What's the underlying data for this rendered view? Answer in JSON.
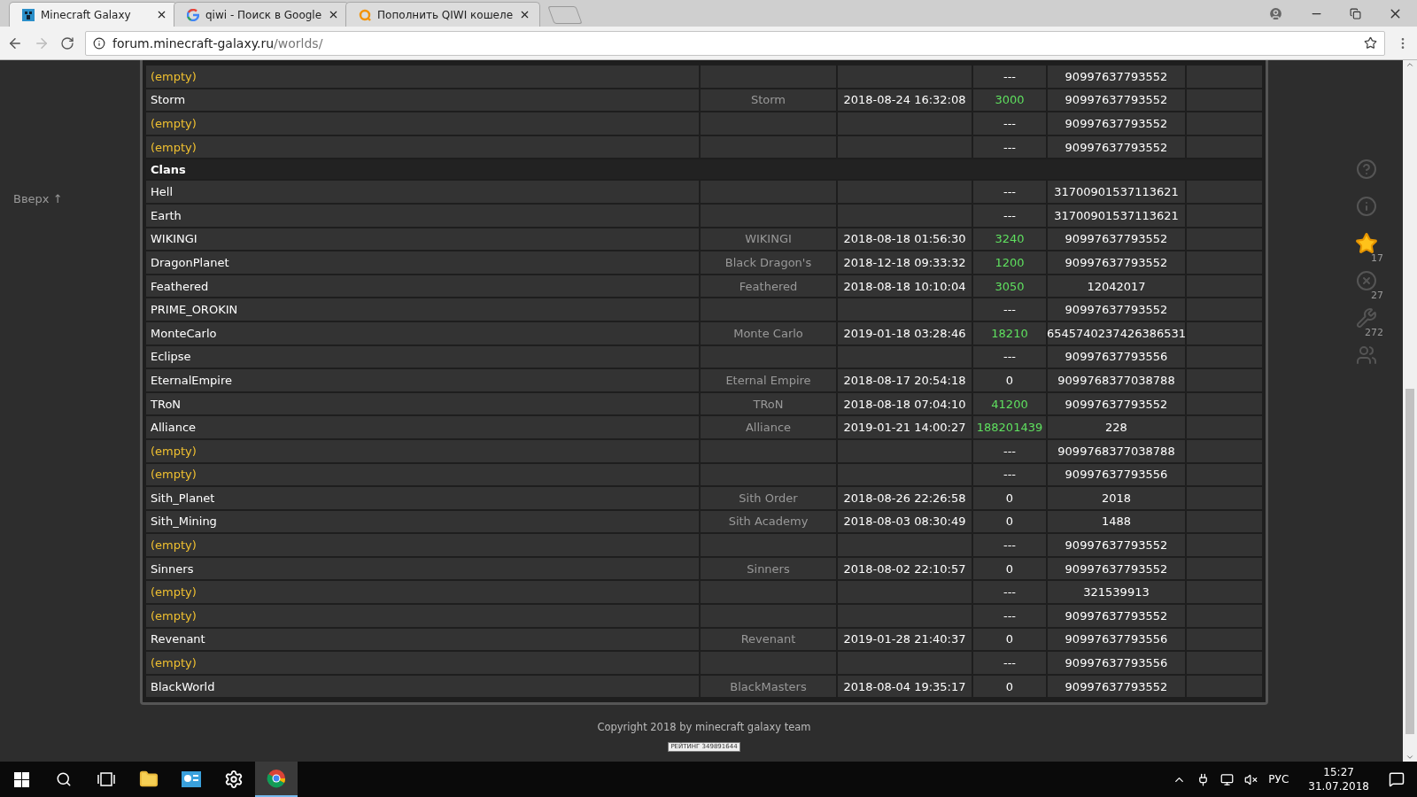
{
  "browser": {
    "tabs": [
      {
        "title": "Minecraft Galaxy",
        "kind": "galaxy",
        "selected": true
      },
      {
        "title": "qiwi - Поиск в Google",
        "kind": "google",
        "selected": false
      },
      {
        "title": "Пополнить QIWI кошеле",
        "kind": "qiwi",
        "selected": false
      }
    ],
    "address": {
      "host": "forum.minecraft-galaxy.ru",
      "path": "/worlds/"
    }
  },
  "page": {
    "up_link": "Вверх ↑",
    "side_icons": [
      {
        "kind": "help"
      },
      {
        "kind": "info"
      },
      {
        "kind": "star",
        "count": "17"
      },
      {
        "kind": "cross",
        "count": "27"
      },
      {
        "kind": "wrench",
        "count": "272"
      },
      {
        "kind": "people"
      }
    ],
    "table": {
      "sections": [
        {
          "rows": [
            {
              "kind": "empty",
              "name": "(empty)",
              "value": "---",
              "value_highlight": false,
              "id": "90997637793552"
            },
            {
              "kind": "world",
              "name": "Storm",
              "group": "Storm",
              "date": "2018-08-24 16:32:08",
              "value": "3000",
              "value_highlight": true,
              "id": "90997637793552"
            },
            {
              "kind": "empty",
              "name": "(empty)",
              "value": "---",
              "value_highlight": false,
              "id": "90997637793552"
            },
            {
              "kind": "empty",
              "name": "(empty)",
              "value": "---",
              "value_highlight": false,
              "id": "90997637793552"
            }
          ]
        },
        {
          "title": "Clans",
          "rows": [
            {
              "kind": "world",
              "name": "Hell",
              "value": "---",
              "value_highlight": false,
              "id": "31700901537113621"
            },
            {
              "kind": "world",
              "name": "Earth",
              "value": "---",
              "value_highlight": false,
              "id": "31700901537113621"
            },
            {
              "kind": "world",
              "name": "WIKINGI",
              "group": "WIKINGI",
              "date": "2018-08-18 01:56:30",
              "value": "3240",
              "value_highlight": true,
              "id": "90997637793552"
            },
            {
              "kind": "world",
              "name": "DragonPlanet",
              "group": "Black Dragon's",
              "date": "2018-12-18 09:33:32",
              "value": "1200",
              "value_highlight": true,
              "id": "90997637793552"
            },
            {
              "kind": "world",
              "name": "Feathered",
              "group": "Feathered",
              "date": "2018-08-18 10:10:04",
              "value": "3050",
              "value_highlight": true,
              "id": "12042017"
            },
            {
              "kind": "world",
              "name": "PRIME_OROKIN",
              "value": "---",
              "value_highlight": false,
              "id": "90997637793552"
            },
            {
              "kind": "world",
              "name": "MonteCarlo",
              "group": "Monte Carlo",
              "date": "2019-01-18 03:28:46",
              "value": "18210",
              "value_highlight": true,
              "id": "6545740237426386531"
            },
            {
              "kind": "world",
              "name": "Eclipse",
              "value": "---",
              "value_highlight": false,
              "id": "90997637793556"
            },
            {
              "kind": "world",
              "name": "EternalEmpire",
              "group": "Eternal Empire",
              "date": "2018-08-17 20:54:18",
              "value": "0",
              "value_highlight": false,
              "id": "9099768377038788"
            },
            {
              "kind": "world",
              "name": "TRoN",
              "group": "TRoN",
              "date": "2018-08-18 07:04:10",
              "value": "41200",
              "value_highlight": true,
              "id": "90997637793552"
            },
            {
              "kind": "world",
              "name": "Alliance",
              "group": "Alliance",
              "date": "2019-01-21 14:00:27",
              "value": "188201439",
              "value_highlight": true,
              "id": "228"
            },
            {
              "kind": "empty",
              "name": "(empty)",
              "value": "---",
              "value_highlight": false,
              "id": "9099768377038788"
            },
            {
              "kind": "empty",
              "name": "(empty)",
              "value": "---",
              "value_highlight": false,
              "id": "90997637793556"
            },
            {
              "kind": "world",
              "name": "Sith_Planet",
              "group": "Sith Order",
              "date": "2018-08-26 22:26:58",
              "value": "0",
              "value_highlight": false,
              "id": "2018"
            },
            {
              "kind": "world",
              "name": "Sith_Mining",
              "group": "Sith Academy",
              "date": "2018-08-03 08:30:49",
              "value": "0",
              "value_highlight": false,
              "id": "1488"
            },
            {
              "kind": "empty",
              "name": "(empty)",
              "value": "---",
              "value_highlight": false,
              "id": "90997637793552"
            },
            {
              "kind": "world",
              "name": "Sinners",
              "group": "Sinners",
              "date": "2018-08-02 22:10:57",
              "value": "0",
              "value_highlight": false,
              "id": "90997637793552"
            },
            {
              "kind": "empty",
              "name": "(empty)",
              "value": "---",
              "value_highlight": false,
              "id": "321539913"
            },
            {
              "kind": "empty",
              "name": "(empty)",
              "value": "---",
              "value_highlight": false,
              "id": "90997637793552"
            },
            {
              "kind": "world",
              "name": "Revenant",
              "group": "Revenant",
              "date": "2019-01-28 21:40:37",
              "value": "0",
              "value_highlight": false,
              "id": "90997637793556"
            },
            {
              "kind": "empty",
              "name": "(empty)",
              "value": "---",
              "value_highlight": false,
              "id": "90997637793556"
            },
            {
              "kind": "world",
              "name": "BlackWorld",
              "group": "BlackMasters",
              "date": "2018-08-04 19:35:17",
              "value": "0",
              "value_highlight": false,
              "id": "90997637793552"
            }
          ]
        }
      ]
    },
    "copyright": "Copyright 2018 by minecraft galaxy team",
    "counter": "РЕЙТИНГ 349891644"
  },
  "taskbar": {
    "apps": [
      {
        "kind": "explorer",
        "selected": false
      },
      {
        "kind": "panel",
        "selected": false
      },
      {
        "kind": "settings",
        "selected": false
      },
      {
        "kind": "chrome",
        "selected": true
      }
    ],
    "language": "РУС",
    "time": "15:27",
    "date": "31.07.2018"
  }
}
